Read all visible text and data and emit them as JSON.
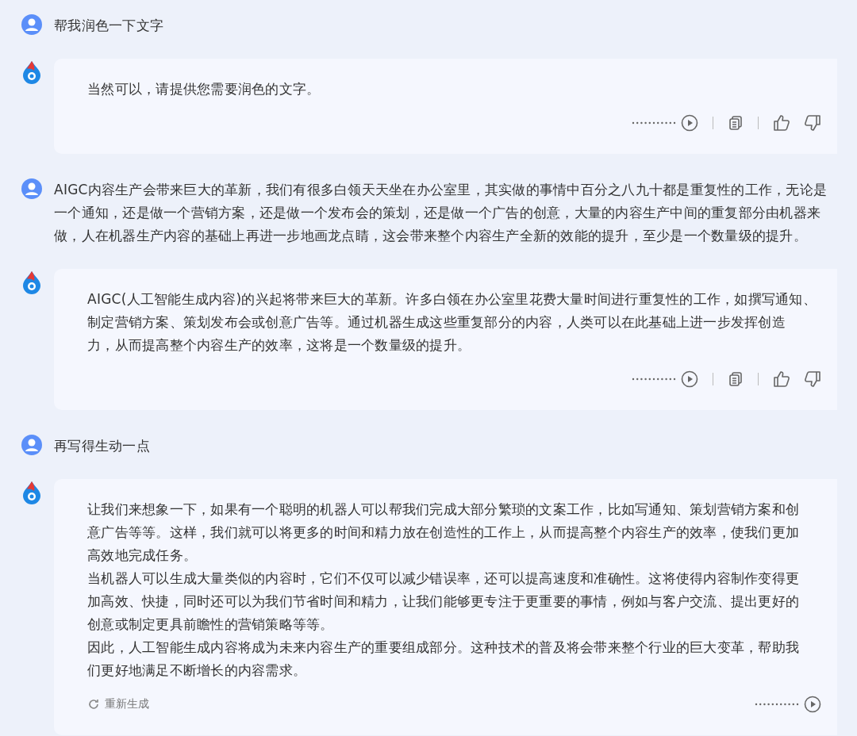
{
  "messages": [
    {
      "kind": "user",
      "lines": [
        "帮我润色一下文字"
      ]
    },
    {
      "kind": "assistant",
      "lines": [
        "当然可以，请提供您需要润色的文字。"
      ],
      "actions": [
        {
          "kind": "play"
        },
        {
          "kind": "copy"
        },
        {
          "kind": "like"
        },
        {
          "kind": "dislike"
        }
      ]
    },
    {
      "kind": "user",
      "lines": [
        "AIGC内容生产会带来巨大的革新，我们有很多白领天天坐在办公室里，其实做的事情中百分之八九十都是重复性的工作，无论是",
        "一个通知，还是做一个营销方案，还是做一个发布会的策划，还是做一个广告的创意，大量的内容生产中间的重复部分由机器来",
        "做，人在机器生产内容的基础上再进一步地画龙点睛，这会带来整个内容生产全新的效能的提升，至少是一个数量级的提升。"
      ]
    },
    {
      "kind": "assistant",
      "lines": [
        "AIGC(人工智能生成内容)的兴起将带来巨大的革新。许多白领在办公室里花费大量时间进行重复性的工作，如撰写通知、",
        "制定营销方案、策划发布会或创意广告等。通过机器生成这些重复部分的内容，人类可以在此基础上进一步发挥创造",
        "力，从而提高整个内容生产的效率，这将是一个数量级的提升。"
      ],
      "actions": [
        {
          "kind": "play"
        },
        {
          "kind": "copy"
        },
        {
          "kind": "like"
        },
        {
          "kind": "dislike"
        }
      ]
    },
    {
      "kind": "user",
      "lines": [
        "再写得生动一点"
      ]
    },
    {
      "kind": "assistant",
      "lines": [
        "让我们来想象一下，如果有一个聪明的机器人可以帮我们完成大部分繁琐的文案工作，比如写通知、策划营销方案和创",
        "意广告等等。这样，我们就可以将更多的时间和精力放在创造性的工作上，从而提高整个内容生产的效率，使我们更加",
        "高效地完成任务。",
        "当机器人可以生成大量类似的内容时，它们不仅可以减少错误率，还可以提高速度和准确性。这将使得内容制作变得更",
        "加高效、快捷，同时还可以为我们节省时间和精力，让我们能够更专注于更重要的事情，例如与客户交流、提出更好的",
        "创意或制定更具前瞻性的营销策略等等。",
        "因此，人工智能生成内容将成为未来内容生产的重要组成部分。这种技术的普及将会带来整个行业的巨大变革，帮助我",
        "们更好地满足不断增长的内容需求。"
      ],
      "regenerate": "重新生成",
      "actions": [
        {
          "kind": "play"
        }
      ]
    }
  ]
}
